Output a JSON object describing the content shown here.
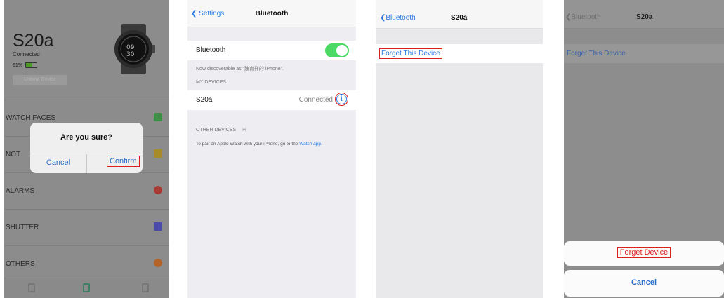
{
  "colors": {
    "ios_blue": "#2a7ae2",
    "highlight_red": "#d9211e",
    "toggle_green": "#4cd964",
    "forget_red": "#e0251c"
  },
  "panel1": {
    "device_name": "S20a",
    "status": "Connected",
    "battery_percent": "61%",
    "battery_level": 0.61,
    "unbind_label": "Unbind Device",
    "list": [
      {
        "label": "WATCH FACES",
        "icon": "watch-faces-icon",
        "color": "#3e8f4a"
      },
      {
        "label": "NOTIFICATIONS",
        "icon": "message-icon",
        "color": "#a88a2a"
      },
      {
        "label": "ALARMS",
        "icon": "alarm-icon",
        "color": "#a83a34"
      },
      {
        "label": "SHUTTER",
        "icon": "camera-icon",
        "color": "#4a4aa8"
      },
      {
        "label": "OTHERS",
        "icon": "gear-icon",
        "color": "#b0632a"
      }
    ],
    "dialog": {
      "title": "Are you sure?",
      "cancel": "Cancel",
      "confirm": "Confirm"
    },
    "tabs": [
      "device-tab-icon",
      "watch-tab-icon",
      "profile-tab-icon"
    ]
  },
  "panel2": {
    "back": "Settings",
    "title": "Bluetooth",
    "bluetooth_label": "Bluetooth",
    "bluetooth_on": true,
    "discoverable": "Now discoverable as “魏育祥的 iPhone”.",
    "my_devices": "MY DEVICES",
    "device": "S20a",
    "device_status": "Connected",
    "info_glyph": "i",
    "other_devices": "OTHER DEVICES",
    "pair_text": "To pair an Apple Watch with your iPhone, go to the",
    "pair_link": "Watch app."
  },
  "panel3": {
    "back": "Bluetooth",
    "title": "S20a",
    "forget": "Forget This Device"
  },
  "panel4": {
    "back": "Bluetooth",
    "title": "S20a",
    "forget": "Forget This Device",
    "forget_device": "Forget Device",
    "cancel": "Cancel"
  }
}
